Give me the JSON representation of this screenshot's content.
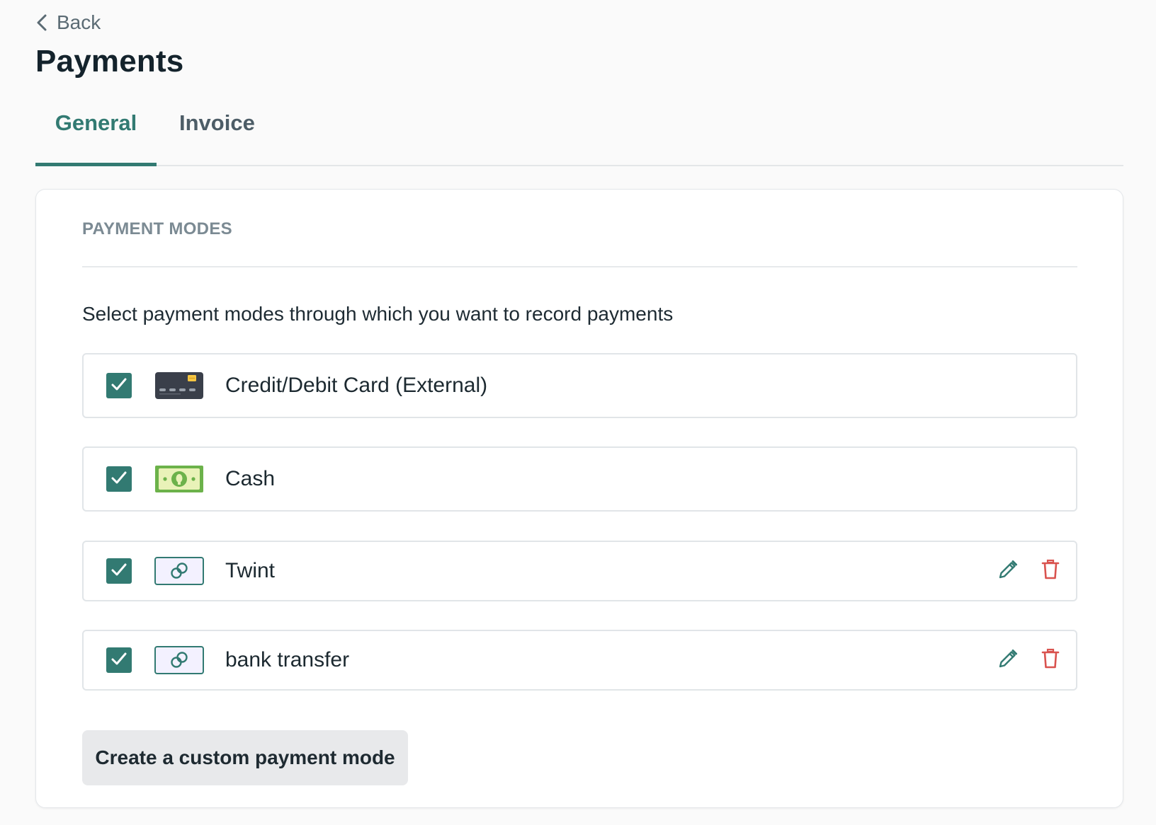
{
  "nav": {
    "back_label": "Back"
  },
  "page": {
    "title": "Payments"
  },
  "tabs": [
    {
      "label": "General",
      "active": true
    },
    {
      "label": "Invoice",
      "active": false
    }
  ],
  "payment_modes": {
    "section_title": "PAYMENT MODES",
    "description": "Select payment modes through which you want to record payments",
    "items": [
      {
        "label": "Credit/Debit Card (External)",
        "checked": true,
        "icon": "credit-card-icon",
        "editable": false
      },
      {
        "label": "Cash",
        "checked": true,
        "icon": "cash-icon",
        "editable": false
      },
      {
        "label": "Twint",
        "checked": true,
        "icon": "custom-payment-icon",
        "editable": true
      },
      {
        "label": "bank transfer",
        "checked": true,
        "icon": "custom-payment-icon",
        "editable": true
      }
    ],
    "create_button_label": "Create a custom payment mode"
  },
  "colors": {
    "accent": "#327a72",
    "delete": "#d9534f",
    "muted_text": "#7b8a93",
    "background": "#fafafa"
  }
}
